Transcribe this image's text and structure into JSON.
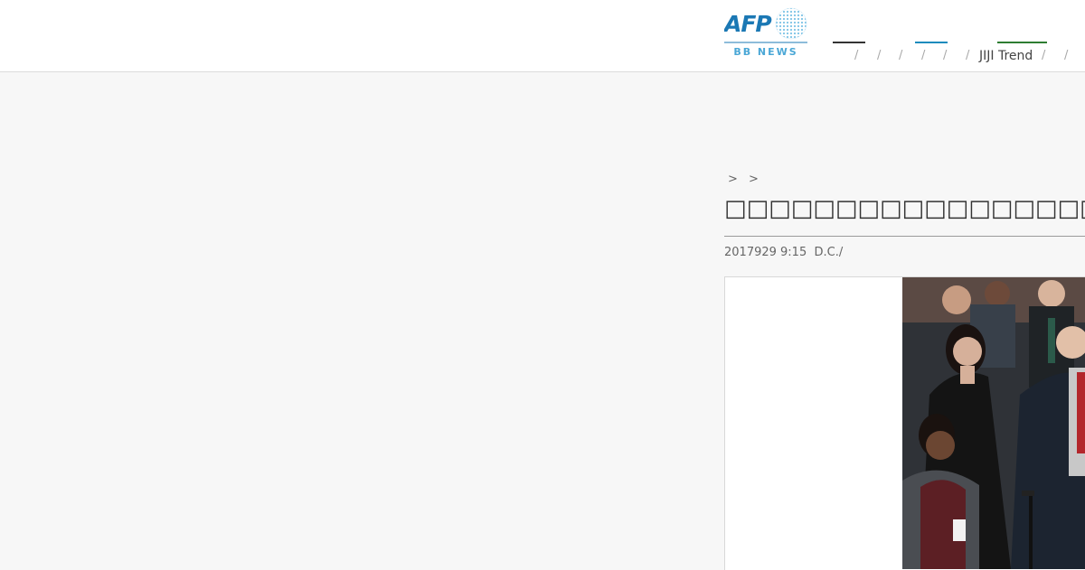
{
  "header": {
    "logo": {
      "brand": "AFP",
      "sub_label": "BB NEWS"
    },
    "nav": {
      "separator": "/",
      "jiji_label": "JIJI Trend",
      "accent_colors": [
        "#333333",
        "#1a8bbd",
        "#2e7d32"
      ]
    }
  },
  "article": {
    "breadcrumb": "> >",
    "title": "3",
    "dateline": "2017929 9:15  D.C./",
    "photo": {
      "alt": "group photo"
    }
  }
}
